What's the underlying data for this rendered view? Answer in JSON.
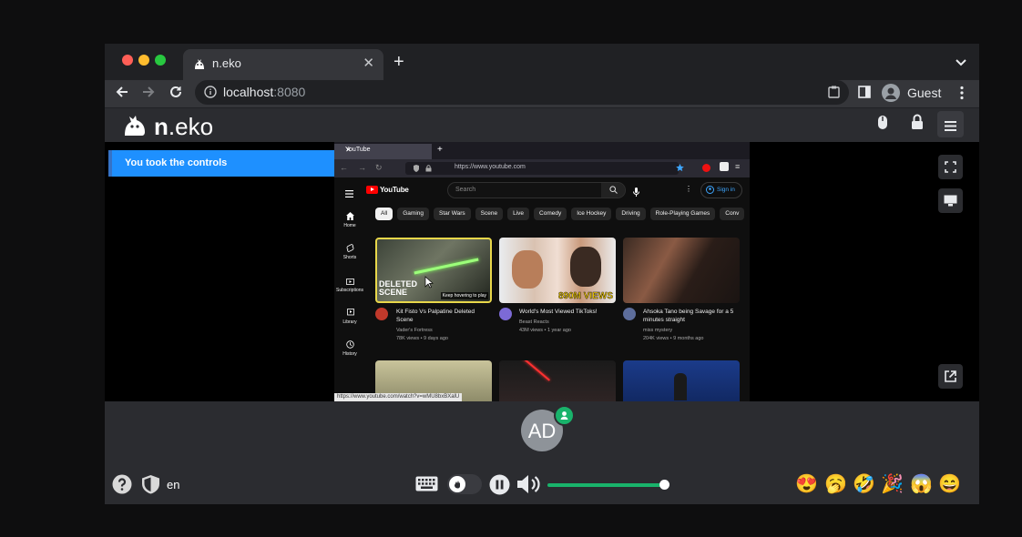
{
  "browser": {
    "tab_title": "n.eko",
    "url_host": "localhost",
    "url_port": ":8080",
    "profile_label": "Guest"
  },
  "app": {
    "logo_bold": "n",
    "logo_rest": ".eko",
    "notice": "You took the controls"
  },
  "remote": {
    "tab_title": "YouTube",
    "url": "https://www.youtube.com",
    "youtube_logo": "YouTube",
    "search_placeholder": "Search",
    "sign_in": "Sign in",
    "chips": [
      "All",
      "Gaming",
      "Star Wars",
      "Scene",
      "Live",
      "Comedy",
      "Ice Hockey",
      "Driving",
      "Role-Playing Games",
      "Conv"
    ],
    "sidebar": [
      "Home",
      "Shorts",
      "Subscriptions",
      "Library",
      "History"
    ],
    "videos": [
      {
        "title": "Kit Fisto Vs Palpatine Deleted Scene",
        "channel": "Vader's Fortress",
        "meta": "78K views • 9 days ago",
        "overlay": "DELETED SCENE",
        "hover": "Keep hovering to play"
      },
      {
        "title": "World's Most Viewed TikToks!",
        "channel": "Beast Reacts",
        "meta": "43M views • 1 year ago",
        "overlay": "890M VIEWS"
      },
      {
        "title": "Ahsoka Tano being Savage for a 5 minutes straight",
        "channel": "miss mystery",
        "meta": "204K views • 9 months ago"
      }
    ],
    "status_url": "https://www.youtube.com/watch?v=wMU8bxBXalU"
  },
  "members": {
    "avatar_initials": "AD"
  },
  "controls": {
    "language": "en",
    "volume": 0.85,
    "emojis": [
      "😍",
      "🥱",
      "🤣",
      "🎉",
      "😱",
      "😄"
    ]
  },
  "colors": {
    "accent": "#19b36b",
    "notice": "#1e90ff"
  }
}
